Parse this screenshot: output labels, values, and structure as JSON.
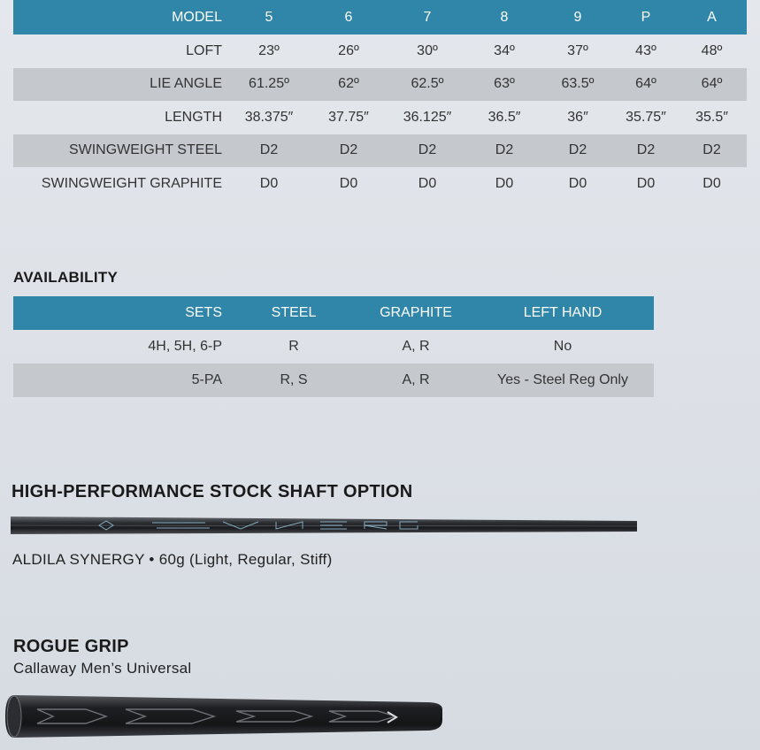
{
  "specs": {
    "header": [
      "MODEL",
      "5",
      "6",
      "7",
      "8",
      "9",
      "P",
      "A"
    ],
    "rows": [
      [
        "LOFT",
        "23º",
        "26º",
        "30º",
        "34º",
        "37º",
        "43º",
        "48º"
      ],
      [
        "LIE ANGLE",
        "61.25º",
        "62º",
        "62.5º",
        "63º",
        "63.5º",
        "64º",
        "64º"
      ],
      [
        "LENGTH",
        "38.375″",
        "37.75″",
        "36.125″",
        "36.5″",
        "36″",
        "35.75″",
        "35.5″"
      ],
      [
        "SWINGWEIGHT STEEL",
        "D2",
        "D2",
        "D2",
        "D2",
        "D2",
        "D2",
        "D2"
      ],
      [
        "SWINGWEIGHT GRAPHITE",
        "D0",
        "D0",
        "D0",
        "D0",
        "D0",
        "D0",
        "D0"
      ]
    ]
  },
  "availability": {
    "title": "AVAILABILITY",
    "header": [
      "SETS",
      "STEEL",
      "GRAPHITE",
      "LEFT HAND"
    ],
    "rows": [
      [
        "4H, 5H, 6-P",
        "R",
        "A, R",
        "No"
      ],
      [
        "5-PA",
        "R, S",
        "A, R",
        "Yes - Steel Reg Only"
      ]
    ]
  },
  "shaft": {
    "title": "HIGH-PERFORMANCE STOCK SHAFT OPTION",
    "caption": "ALDILA SYNERGY • 60g (Light, Regular, Stiff)"
  },
  "grip": {
    "title": "ROGUE GRIP",
    "subtitle": "Callaway Men’s Universal"
  },
  "colors": {
    "header_bg": "#2f86a8",
    "shade_bg": "#c5c8cd",
    "page_bg": "#e0e4e9"
  }
}
